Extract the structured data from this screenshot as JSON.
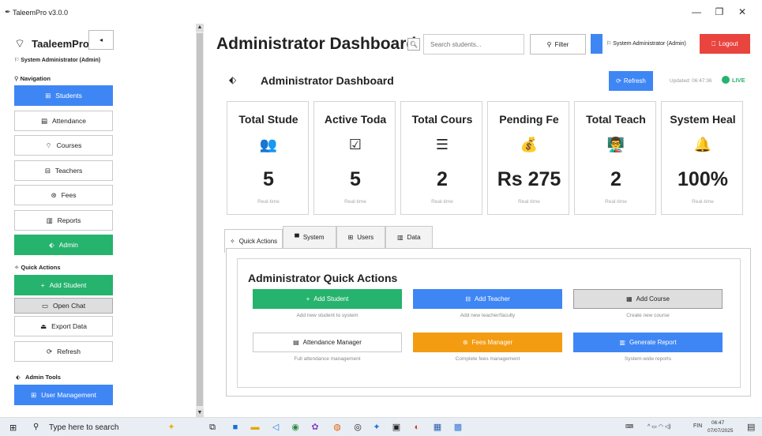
{
  "window": {
    "title": "TaleemPro v3.0.0",
    "minimize": "—",
    "maximize": "❐",
    "close": "✕"
  },
  "sidebar": {
    "app_name": "TaaleemPro",
    "logo_icon": "⌔",
    "collapse_label": "◂",
    "user": "⚐ System Administrator (Admin)",
    "navigation_label": "⚲ Navigation",
    "nav_items": [
      {
        "label": "Students",
        "icon": "⊞",
        "style": "blue"
      },
      {
        "label": "Attendance",
        "icon": "▤",
        "style": "plain"
      },
      {
        "label": "Courses",
        "icon": "⌔",
        "style": "plain"
      },
      {
        "label": "Teachers",
        "icon": "⊟",
        "style": "plain"
      },
      {
        "label": "Fees",
        "icon": "⊛",
        "style": "plain"
      },
      {
        "label": "Reports",
        "icon": "▥",
        "style": "plain"
      },
      {
        "label": "Admin",
        "icon": "⬖",
        "style": "green"
      }
    ],
    "quick_actions_label": "✧ Quick Actions",
    "quick_items": [
      {
        "label": "Add Student",
        "icon": "+",
        "style": "green"
      },
      {
        "label": "Open Chat",
        "icon": "▭",
        "style": "gray"
      },
      {
        "label": "Export Data",
        "icon": "⏏",
        "style": "plain"
      },
      {
        "label": "Refresh",
        "icon": "⟳",
        "style": "plain"
      }
    ],
    "admin_tools_label": "Admin Tools",
    "admin_items": [
      {
        "label": "User Management",
        "icon": "⊞",
        "style": "blue"
      }
    ]
  },
  "header": {
    "title": "Administrator Dashboard",
    "search_placeholder": "Search students...",
    "filter_label": "Filter",
    "user_label": "⚐ System Administrator (Admin)",
    "logout_label": "Logout"
  },
  "dashboard": {
    "title": "Administrator Dashboard",
    "refresh_label": "Refresh",
    "updated": "Updated: 06:47:36",
    "live": "LIVE"
  },
  "cards": [
    {
      "title": "Total Stude",
      "icon": "👥",
      "value": "5",
      "sub": "Real-time"
    },
    {
      "title": "Active Toda",
      "icon": "☑",
      "value": "5",
      "sub": "Real-time"
    },
    {
      "title": "Total Cours",
      "icon": "☰",
      "value": "2",
      "sub": "Real-time"
    },
    {
      "title": "Pending Fe",
      "icon": "💰",
      "value": "Rs 275",
      "sub": "Real-time"
    },
    {
      "title": "Total Teach",
      "icon": "👨‍🏫",
      "value": "2",
      "sub": "Real-time"
    },
    {
      "title": "System Heal",
      "icon": "🔔",
      "value": "100%",
      "sub": "Real-time"
    }
  ],
  "tabs": [
    {
      "label": "Quick Actions",
      "icon": "✧"
    },
    {
      "label": "System",
      "icon": "▀"
    },
    {
      "label": "Users",
      "icon": "⊞"
    },
    {
      "label": "Data",
      "icon": "▥"
    }
  ],
  "quick_panel": {
    "title": "Administrator Quick Actions",
    "actions": [
      {
        "label": "Add Student",
        "icon": "+",
        "caption": "Add new student to system",
        "style": "green"
      },
      {
        "label": "Add Teacher",
        "icon": "⊟",
        "caption": "Add new teacher/faculty",
        "style": "blue"
      },
      {
        "label": "Add Course",
        "icon": "▦",
        "caption": "Create new course",
        "style": "gray"
      },
      {
        "label": "Attendance Manager",
        "icon": "▤",
        "caption": "Full attendance management",
        "style": "plain"
      },
      {
        "label": "Fees Manager",
        "icon": "⊛",
        "caption": "Complete fees management",
        "style": "orange"
      },
      {
        "label": "Generate Report",
        "icon": "▥",
        "caption": "System-wide reports",
        "style": "blue"
      }
    ]
  },
  "taskbar": {
    "search_text": "Type here to search",
    "tray_lang": "FIN",
    "time": "06:47",
    "date": "07/07/2025"
  }
}
